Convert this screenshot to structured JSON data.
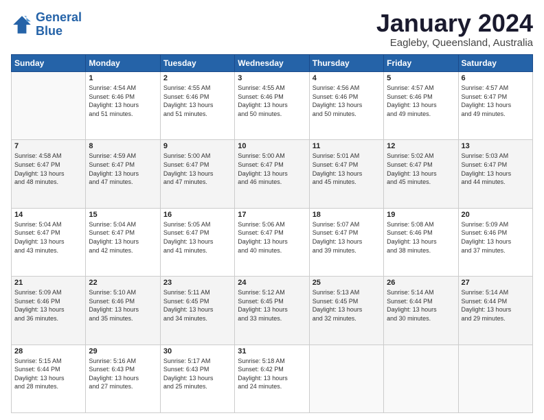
{
  "logo": {
    "line1": "General",
    "line2": "Blue"
  },
  "title": "January 2024",
  "subtitle": "Eagleby, Queensland, Australia",
  "weekdays": [
    "Sunday",
    "Monday",
    "Tuesday",
    "Wednesday",
    "Thursday",
    "Friday",
    "Saturday"
  ],
  "weeks": [
    [
      {
        "day": "",
        "empty": true
      },
      {
        "day": "1",
        "sunrise": "4:54 AM",
        "sunset": "6:46 PM",
        "daylight": "13 hours and 51 minutes."
      },
      {
        "day": "2",
        "sunrise": "4:55 AM",
        "sunset": "6:46 PM",
        "daylight": "13 hours and 51 minutes."
      },
      {
        "day": "3",
        "sunrise": "4:55 AM",
        "sunset": "6:46 PM",
        "daylight": "13 hours and 50 minutes."
      },
      {
        "day": "4",
        "sunrise": "4:56 AM",
        "sunset": "6:46 PM",
        "daylight": "13 hours and 50 minutes."
      },
      {
        "day": "5",
        "sunrise": "4:57 AM",
        "sunset": "6:46 PM",
        "daylight": "13 hours and 49 minutes."
      },
      {
        "day": "6",
        "sunrise": "4:57 AM",
        "sunset": "6:47 PM",
        "daylight": "13 hours and 49 minutes."
      }
    ],
    [
      {
        "day": "7",
        "sunrise": "4:58 AM",
        "sunset": "6:47 PM",
        "daylight": "13 hours and 48 minutes."
      },
      {
        "day": "8",
        "sunrise": "4:59 AM",
        "sunset": "6:47 PM",
        "daylight": "13 hours and 47 minutes."
      },
      {
        "day": "9",
        "sunrise": "5:00 AM",
        "sunset": "6:47 PM",
        "daylight": "13 hours and 47 minutes."
      },
      {
        "day": "10",
        "sunrise": "5:00 AM",
        "sunset": "6:47 PM",
        "daylight": "13 hours and 46 minutes."
      },
      {
        "day": "11",
        "sunrise": "5:01 AM",
        "sunset": "6:47 PM",
        "daylight": "13 hours and 45 minutes."
      },
      {
        "day": "12",
        "sunrise": "5:02 AM",
        "sunset": "6:47 PM",
        "daylight": "13 hours and 45 minutes."
      },
      {
        "day": "13",
        "sunrise": "5:03 AM",
        "sunset": "6:47 PM",
        "daylight": "13 hours and 44 minutes."
      }
    ],
    [
      {
        "day": "14",
        "sunrise": "5:04 AM",
        "sunset": "6:47 PM",
        "daylight": "13 hours and 43 minutes."
      },
      {
        "day": "15",
        "sunrise": "5:04 AM",
        "sunset": "6:47 PM",
        "daylight": "13 hours and 42 minutes."
      },
      {
        "day": "16",
        "sunrise": "5:05 AM",
        "sunset": "6:47 PM",
        "daylight": "13 hours and 41 minutes."
      },
      {
        "day": "17",
        "sunrise": "5:06 AM",
        "sunset": "6:47 PM",
        "daylight": "13 hours and 40 minutes."
      },
      {
        "day": "18",
        "sunrise": "5:07 AM",
        "sunset": "6:47 PM",
        "daylight": "13 hours and 39 minutes."
      },
      {
        "day": "19",
        "sunrise": "5:08 AM",
        "sunset": "6:46 PM",
        "daylight": "13 hours and 38 minutes."
      },
      {
        "day": "20",
        "sunrise": "5:09 AM",
        "sunset": "6:46 PM",
        "daylight": "13 hours and 37 minutes."
      }
    ],
    [
      {
        "day": "21",
        "sunrise": "5:09 AM",
        "sunset": "6:46 PM",
        "daylight": "13 hours and 36 minutes."
      },
      {
        "day": "22",
        "sunrise": "5:10 AM",
        "sunset": "6:46 PM",
        "daylight": "13 hours and 35 minutes."
      },
      {
        "day": "23",
        "sunrise": "5:11 AM",
        "sunset": "6:45 PM",
        "daylight": "13 hours and 34 minutes."
      },
      {
        "day": "24",
        "sunrise": "5:12 AM",
        "sunset": "6:45 PM",
        "daylight": "13 hours and 33 minutes."
      },
      {
        "day": "25",
        "sunrise": "5:13 AM",
        "sunset": "6:45 PM",
        "daylight": "13 hours and 32 minutes."
      },
      {
        "day": "26",
        "sunrise": "5:14 AM",
        "sunset": "6:44 PM",
        "daylight": "13 hours and 30 minutes."
      },
      {
        "day": "27",
        "sunrise": "5:14 AM",
        "sunset": "6:44 PM",
        "daylight": "13 hours and 29 minutes."
      }
    ],
    [
      {
        "day": "28",
        "sunrise": "5:15 AM",
        "sunset": "6:44 PM",
        "daylight": "13 hours and 28 minutes."
      },
      {
        "day": "29",
        "sunrise": "5:16 AM",
        "sunset": "6:43 PM",
        "daylight": "13 hours and 27 minutes."
      },
      {
        "day": "30",
        "sunrise": "5:17 AM",
        "sunset": "6:43 PM",
        "daylight": "13 hours and 25 minutes."
      },
      {
        "day": "31",
        "sunrise": "5:18 AM",
        "sunset": "6:42 PM",
        "daylight": "13 hours and 24 minutes."
      },
      {
        "day": "",
        "empty": true
      },
      {
        "day": "",
        "empty": true
      },
      {
        "day": "",
        "empty": true
      }
    ]
  ]
}
